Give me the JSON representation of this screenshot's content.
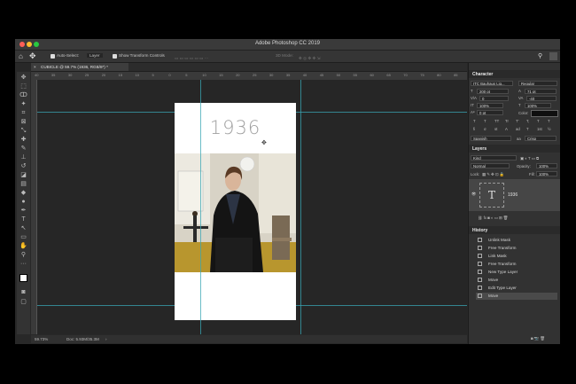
{
  "app": {
    "title": "Adobe Photoshop CC 2019"
  },
  "options_bar": {
    "auto_select_label": "Auto-Select:",
    "auto_select_value": "Layer",
    "show_transform_label": "Show Transform Controls",
    "three_d_mode": "3D Mode:"
  },
  "document_tab": {
    "label": "CUBICLE @ 59.7% (1936, RGB/8*) *"
  },
  "ruler_top": {
    "ticks": [
      "40",
      "35",
      "30",
      "25",
      "20",
      "15",
      "10",
      "5",
      "0",
      "5",
      "10",
      "15",
      "20",
      "25",
      "30",
      "35",
      "40",
      "45",
      "50",
      "55",
      "60",
      "65",
      "70",
      "75",
      "80",
      "85"
    ]
  },
  "canvas": {
    "document_text": "1936"
  },
  "status_bar": {
    "zoom": "59.73%",
    "doc_size": "Doc: 5.93M/35.3M"
  },
  "character_panel": {
    "title": "Character",
    "font_family": "ITC Bauhaus Lig...",
    "font_style": "Regular",
    "font_size": "200 pt",
    "leading": "71 pt",
    "kerning": "0",
    "tracking": "-40",
    "vertical_scale": "100%",
    "horizontal_scale": "100%",
    "baseline_shift": "0 pt",
    "color_label": "Color:",
    "language": "Spanish",
    "antialias_label": "aa",
    "antialias": "Crisp",
    "style_buttons": [
      "T",
      "T",
      "TT",
      "Tr",
      "T'",
      "T,",
      "T",
      "T"
    ],
    "feature_buttons": [
      "fi",
      "σ",
      "st",
      "A",
      "ad",
      "T",
      "1st",
      "½"
    ]
  },
  "layers_panel": {
    "title": "Layers",
    "filter_kind": "Kind",
    "blend_mode": "Normal",
    "opacity_label": "Opacity:",
    "opacity": "100%",
    "lock_label": "Lock:",
    "fill_label": "Fill:",
    "fill": "100%",
    "layer_name": "1936",
    "layer_thumb": "T"
  },
  "history_panel": {
    "title": "History",
    "items": [
      "Unlink Mask",
      "Free Transform",
      "Link Mask",
      "Free Transform",
      "New Type Layer",
      "Move",
      "Edit Type Layer",
      "Move"
    ]
  },
  "icons": [
    "home-icon",
    "move-tool-icon",
    "marquee-icon",
    "lasso-icon",
    "crop-icon",
    "eyedropper-icon",
    "brush-icon",
    "eraser-icon",
    "type-tool-icon",
    "hand-icon",
    "zoom-icon",
    "eye-icon",
    "trash-icon"
  ],
  "colors": {
    "guide": "#3aa6b4",
    "workspace": "#282828",
    "panel": "#323232",
    "history_active": "#4a4a4a"
  }
}
